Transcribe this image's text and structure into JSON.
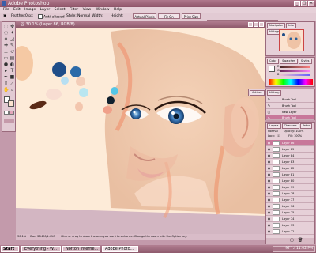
{
  "window": {
    "title": "Adobe Photoshop"
  },
  "menu": [
    "File",
    "Edit",
    "Image",
    "Layer",
    "Select",
    "Filter",
    "View",
    "Window",
    "Help"
  ],
  "options": {
    "feather_label": "Feather:",
    "feather_value": "0 px",
    "antialias_label": "Anti-aliased",
    "style_label": "Style:",
    "style_value": "Normal",
    "width_label": "Width:",
    "height_label": "Height:",
    "buttons": [
      "Actual Pixels",
      "Fit On Screen",
      "Print Size"
    ],
    "tabs": [
      "Brushes",
      "Tool Presets",
      "Layer Comps"
    ]
  },
  "document": {
    "title": "@ 30.1% (Layer 86, RGB/8)",
    "zoom": "30.1%",
    "doc_info": "Doc: 28.2M/1.41G",
    "status_hint": "Click or drag to show the area you want to enhance. Change the zoom with the Option key."
  },
  "navigator": {
    "tabs": [
      "Navigator",
      "Info",
      "Histogram"
    ]
  },
  "color": {
    "tabs": [
      "Color",
      "Swatches",
      "Styles"
    ],
    "channels": [
      "R",
      "G",
      "B"
    ]
  },
  "history": {
    "tabs": [
      "History",
      "Actions"
    ],
    "items": [
      "Brush Tool",
      "Brush Tool",
      "New Layer",
      "Brush Tool"
    ]
  },
  "layers": {
    "tabs": [
      "Layers",
      "Channels",
      "Paths"
    ],
    "mode": "Normal",
    "opacity_label": "Opacity:",
    "opacity": "100%",
    "lock_label": "Lock:",
    "fill_label": "Fill:",
    "fill": "100%",
    "items": [
      "Layer 86",
      "Layer 85",
      "Layer 84",
      "Layer 83",
      "Layer 82",
      "Layer 81",
      "Layer 80",
      "Layer 79",
      "Layer 78",
      "Layer 77",
      "Layer 76",
      "Layer 75",
      "Layer 74",
      "Layer 73",
      "Layer 72"
    ]
  },
  "taskbar": {
    "start": "Start",
    "tasks": [
      "Everything - W...",
      "Norton Interne...",
      "Adobe Photo..."
    ],
    "clock": "11:02 PM",
    "tray_label": "97°"
  },
  "colors": {
    "chrome": "#8e5468",
    "panel": "#e6d0d8",
    "accent": "#c8779a",
    "skin": "#f6d2b4"
  },
  "icons": {
    "tools": [
      "marquee-icon",
      "move-icon",
      "lasso-icon",
      "magic-wand-icon",
      "crop-icon",
      "slice-icon",
      "healing-icon",
      "brush-icon",
      "stamp-icon",
      "history-brush-icon",
      "eraser-icon",
      "gradient-icon",
      "blur-icon",
      "dodge-icon",
      "path-icon",
      "type-icon",
      "pen-icon",
      "shape-icon",
      "notes-icon",
      "eyedropper-icon",
      "hand-icon",
      "zoom-icon"
    ]
  }
}
